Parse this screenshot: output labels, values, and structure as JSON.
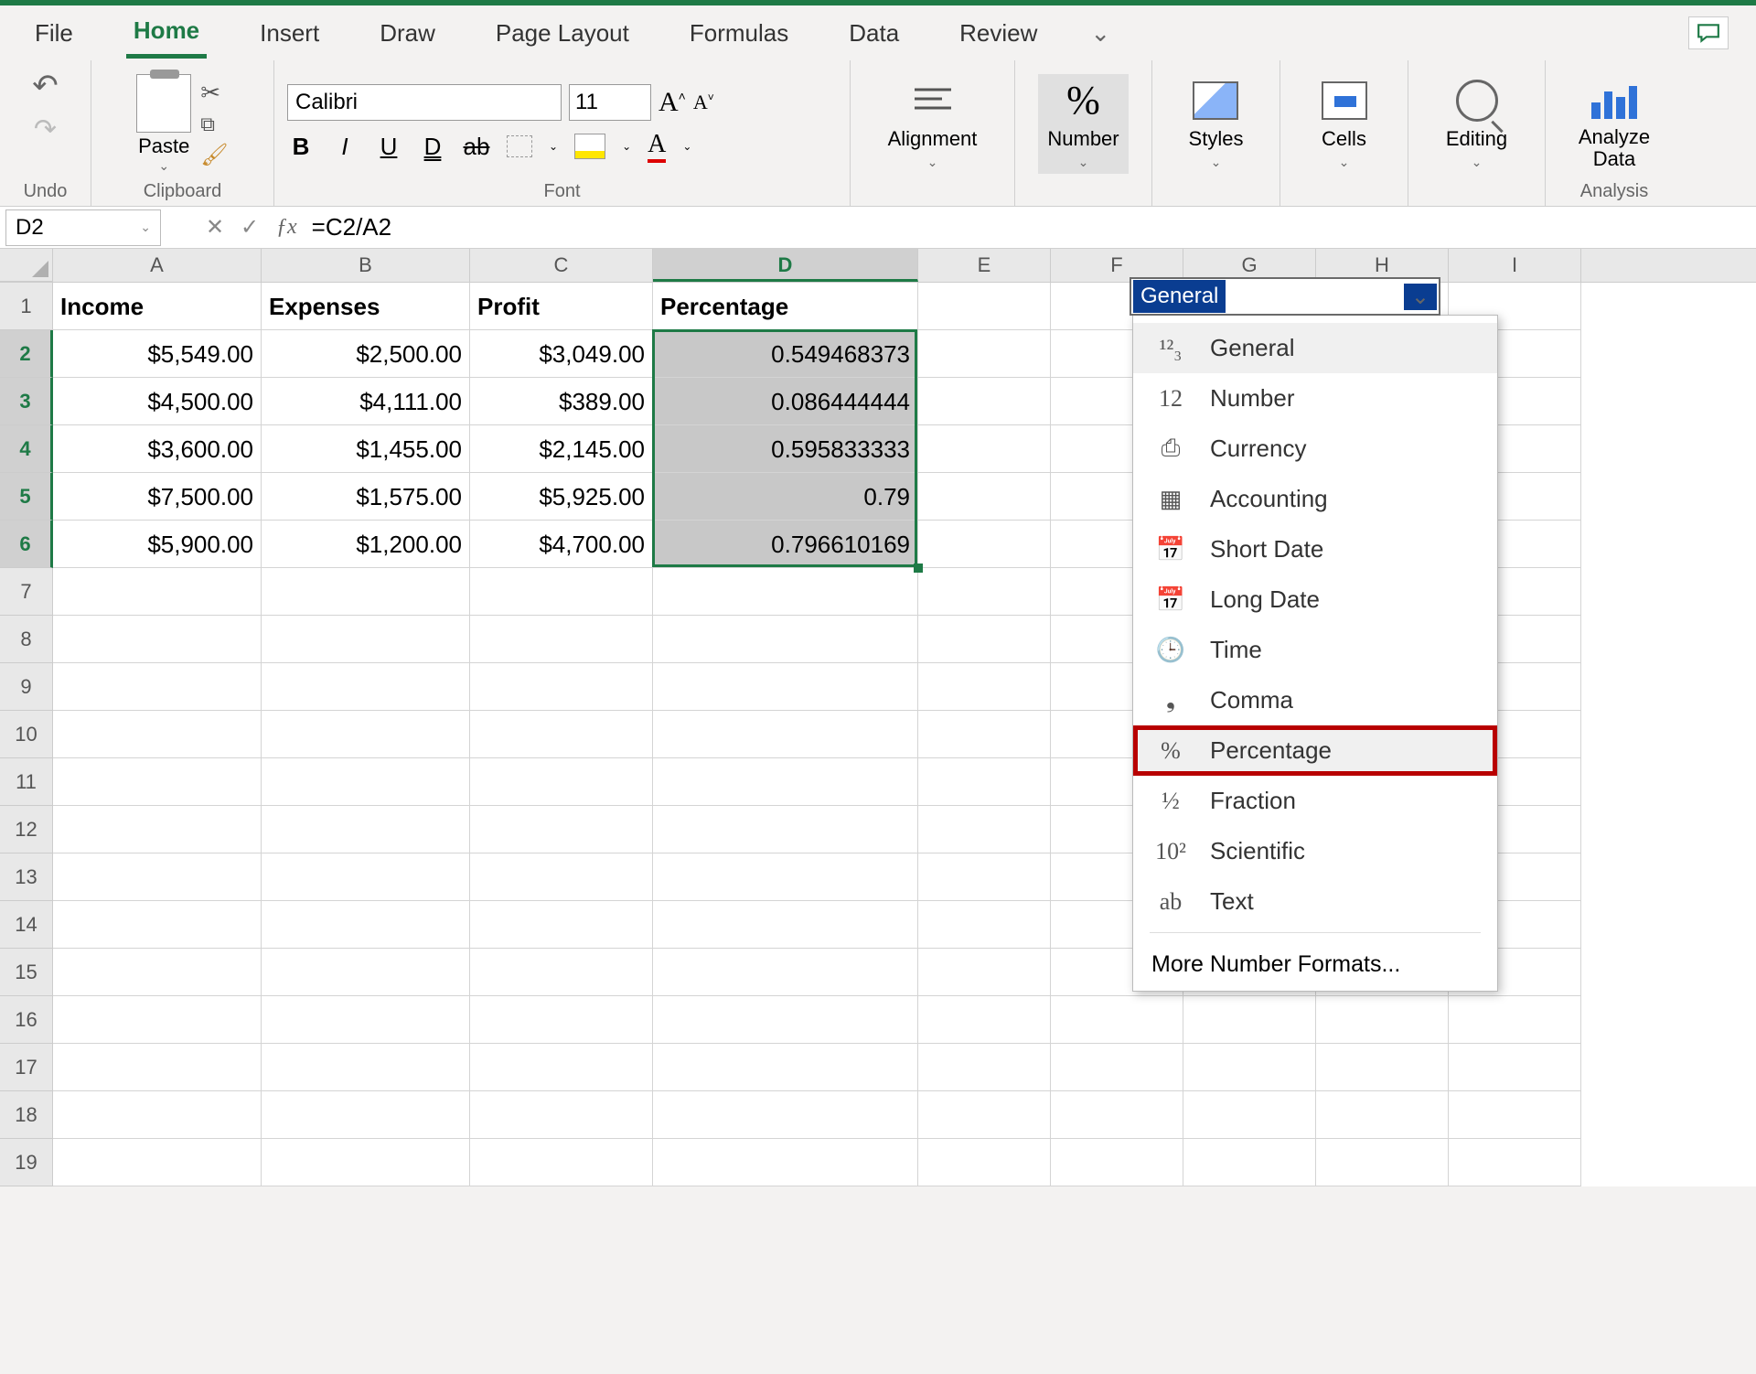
{
  "tabs": {
    "file": "File",
    "home": "Home",
    "insert": "Insert",
    "draw": "Draw",
    "page_layout": "Page Layout",
    "formulas": "Formulas",
    "data": "Data",
    "review": "Review"
  },
  "ribbon": {
    "undo_label": "Undo",
    "clipboard_label": "Clipboard",
    "paste": "Paste",
    "font_label": "Font",
    "font_name": "Calibri",
    "font_size": "11",
    "alignment": "Alignment",
    "number": "Number",
    "styles": "Styles",
    "cells": "Cells",
    "editing": "Editing",
    "analyze": "Analyze Data",
    "analyze_group": "Analysis"
  },
  "formula_bar": {
    "cell_ref": "D2",
    "formula": "=C2/A2"
  },
  "columns": [
    "A",
    "B",
    "C",
    "D",
    "E",
    "F",
    "G",
    "H",
    "I"
  ],
  "row_count": 19,
  "selected_col": "D",
  "selected_rows": [
    2,
    3,
    4,
    5,
    6
  ],
  "table": {
    "headers": [
      "Income",
      "Expenses",
      "Profit",
      "Percentage"
    ],
    "rows": [
      {
        "A": "$5,549.00",
        "B": "$2,500.00",
        "C": "$3,049.00",
        "D": "0.549468373"
      },
      {
        "A": "$4,500.00",
        "B": "$4,111.00",
        "C": "$389.00",
        "D": "0.086444444"
      },
      {
        "A": "$3,600.00",
        "B": "$1,455.00",
        "C": "$2,145.00",
        "D": "0.595833333"
      },
      {
        "A": "$7,500.00",
        "B": "$1,575.00",
        "C": "$5,925.00",
        "D": "0.79"
      },
      {
        "A": "$5,900.00",
        "B": "$1,200.00",
        "C": "$4,700.00",
        "D": "0.796610169"
      }
    ]
  },
  "number_format": {
    "current": "General",
    "options": [
      "General",
      "Number",
      "Currency",
      "Accounting",
      "Short Date",
      "Long Date",
      "Time",
      "Comma",
      "Percentage",
      "Fraction",
      "Scientific",
      "Text"
    ],
    "highlighted": "Percentage",
    "more": "More Number Formats..."
  }
}
